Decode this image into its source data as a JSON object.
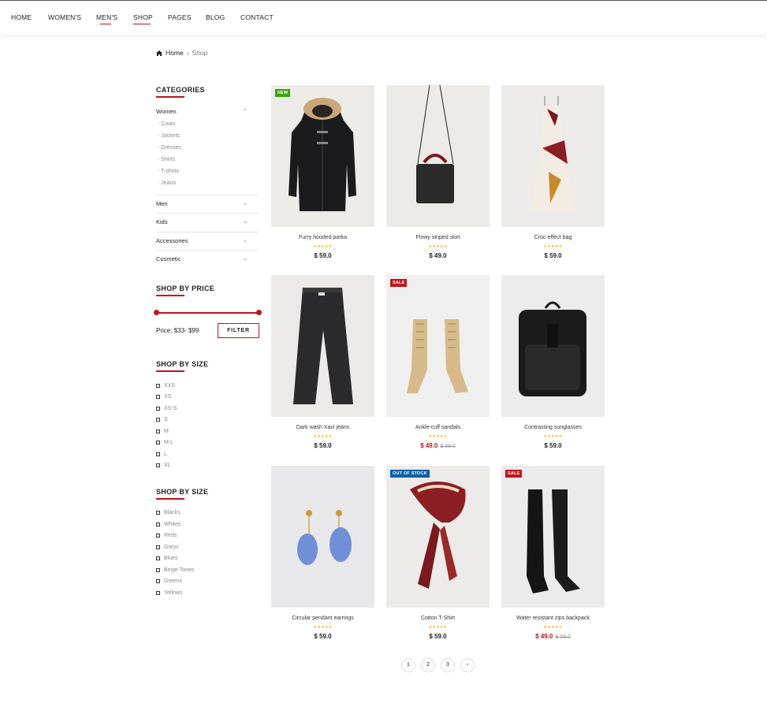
{
  "nav": {
    "items": [
      "HOME",
      "WOMEN'S",
      "MEN'S",
      "SHOP",
      "PAGES",
      "BLOG",
      "CONTACT"
    ],
    "active": "SHOP"
  },
  "breadcrumb": {
    "home": "Home",
    "separator": "›",
    "current": "Shop"
  },
  "categories": {
    "title": "CATEGORIES",
    "women": {
      "label": "Women",
      "sub": [
        "Coats",
        "Jackets",
        "Dresses",
        "Shirts",
        "T-shirts",
        "Jeans"
      ]
    },
    "others": [
      "Men",
      "Kids",
      "Accessories",
      "Cosmetic"
    ]
  },
  "price_filter": {
    "title": "SHOP BY PRICE",
    "label": "Price:",
    "min": "$33",
    "max": "$99",
    "range_fraction": [
      0,
      1
    ],
    "button": "FILTER"
  },
  "size_filter": {
    "title": "SHOP BY SIZE",
    "options": [
      "XXS",
      "XS",
      "XS-S",
      "S",
      "M",
      "M-L",
      "L",
      "XL"
    ]
  },
  "color_filter": {
    "title": "SHOP BY SIZE",
    "options": [
      "Blacks",
      "Whites",
      "Reds",
      "Greys",
      "Blues",
      "Beige Tones",
      "Greens",
      "Yellows"
    ]
  },
  "products": [
    {
      "name": "Furry hooded parka",
      "price": "$ 59.0",
      "old_price": "",
      "badge": "NEW",
      "badge_type": "new",
      "rating": 5,
      "image": "coat-image"
    },
    {
      "name": "Flowy striped skirt",
      "price": "$ 49.0",
      "old_price": "",
      "badge": "",
      "badge_type": "",
      "rating": 5,
      "image": "bag-image"
    },
    {
      "name": "Croc-effect bag",
      "price": "$ 59.0",
      "old_price": "",
      "badge": "",
      "badge_type": "",
      "rating": 5,
      "image": "dress-image"
    },
    {
      "name": "Dark wash Xavi jeans",
      "price": "$ 59.0",
      "old_price": "",
      "badge": "",
      "badge_type": "",
      "rating": 5,
      "image": "jeans-image"
    },
    {
      "name": "Ankle-cuff sandals",
      "price": "$ 49.0",
      "old_price": "$ 59.0",
      "badge": "SALE",
      "badge_type": "sale",
      "rating": 5,
      "image": "boots-image"
    },
    {
      "name": "Contrasting sunglasses",
      "price": "$ 59.0",
      "old_price": "",
      "badge": "",
      "badge_type": "",
      "rating": 5,
      "image": "backpack-image"
    },
    {
      "name": "Circular pendant earrings",
      "price": "$ 59.0",
      "old_price": "",
      "badge": "",
      "badge_type": "",
      "rating": 5,
      "image": "earrings-image"
    },
    {
      "name": "Cotton T-Shirt",
      "price": "$ 59.0",
      "old_price": "",
      "badge": "OUT OF STOCK",
      "badge_type": "out",
      "rating": 5,
      "image": "scarf-image"
    },
    {
      "name": "Water resistant zips backpack",
      "price": "$ 49.0",
      "old_price": "$ 59.0",
      "badge": "SALE",
      "badge_type": "sale",
      "rating": 5,
      "image": "tall-boots-image"
    }
  ],
  "stars_text": "★★★★★",
  "pagination": [
    "1",
    "2",
    "3",
    "›"
  ],
  "colors": {
    "accent": "#c0141c",
    "new_badge": "#3ba30a",
    "out_badge": "#0b5fa8",
    "star": "#f2b01e"
  }
}
